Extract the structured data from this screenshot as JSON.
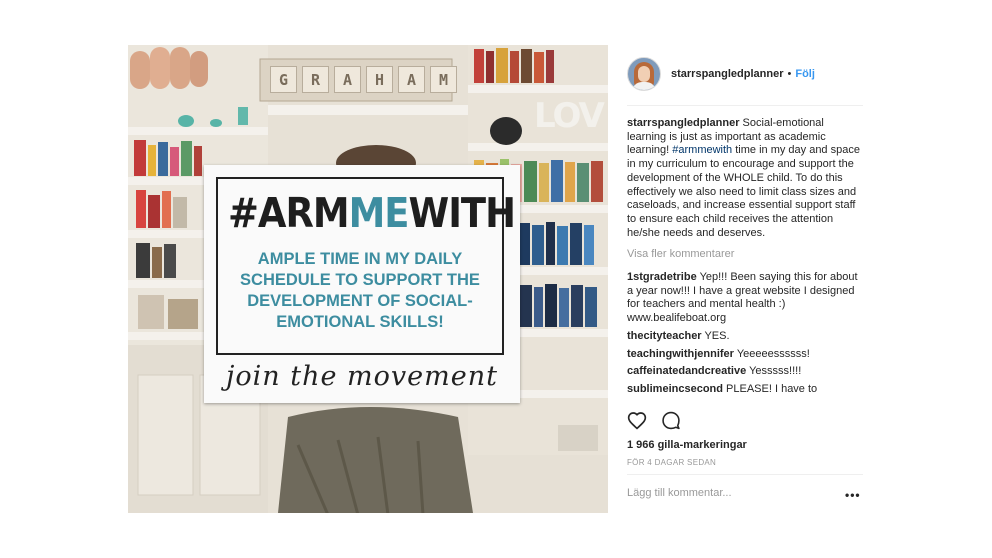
{
  "post": {
    "username": "starrspangledplanner",
    "separator": "•",
    "follow_label": "Följ",
    "caption_text": "Social-emotional learning is just as important as academic learning!",
    "caption_hashtag": "#armmewith",
    "caption_rest": "time in my day and space in my curriculum to encourage and support the development of the WHOLE child. To do this effectively we also need to limit class sizes and caseloads, and increase essential support staff to ensure each child receives the attention he/she needs and deserves.",
    "view_more_label": "Visa fler kommentarer",
    "comments": [
      {
        "user": "1stgradetribe",
        "text": "Yep!!! Been saying this for about a year now!!! I have a great website I designed for teachers and mental health :) www.bealifeboat.org"
      },
      {
        "user": "thecityteacher",
        "text": "YES."
      },
      {
        "user": "teachingwithjennifer",
        "text": "Yeeeeessssss!"
      },
      {
        "user": "caffeinatedandcreative",
        "text": "Yesssss!!!!"
      },
      {
        "user": "sublimeincsecond",
        "text": "PLEASE! I have to"
      }
    ],
    "likes": "1 966 gilla-markeringar",
    "timestamp": "FÖR 4 DAGAR SEDAN",
    "add_comment_placeholder": "Lägg till kommentar...",
    "more_options": "•••",
    "icons": {
      "like": "heart-icon",
      "comment": "comment-icon",
      "options": "more-options-icon"
    },
    "colors": {
      "link": "#3897f0",
      "hashtag": "#003569",
      "muted": "#999999",
      "sign_accent": "#3d8da0"
    }
  },
  "photo": {
    "shelf_tiles": [
      "G",
      "R",
      "A",
      "H",
      "A",
      "M"
    ],
    "shelf_word": "LOV",
    "sign": {
      "hashtag_prefix": "#ARM",
      "hashtag_accent": "ME",
      "hashtag_suffix": "WITH",
      "body": "AMPLE TIME IN MY DAILY SCHEDULE TO SUPPORT THE DEVELOPMENT OF SOCIAL-EMOTIONAL SKILLS!",
      "footer": "join the movement"
    }
  }
}
